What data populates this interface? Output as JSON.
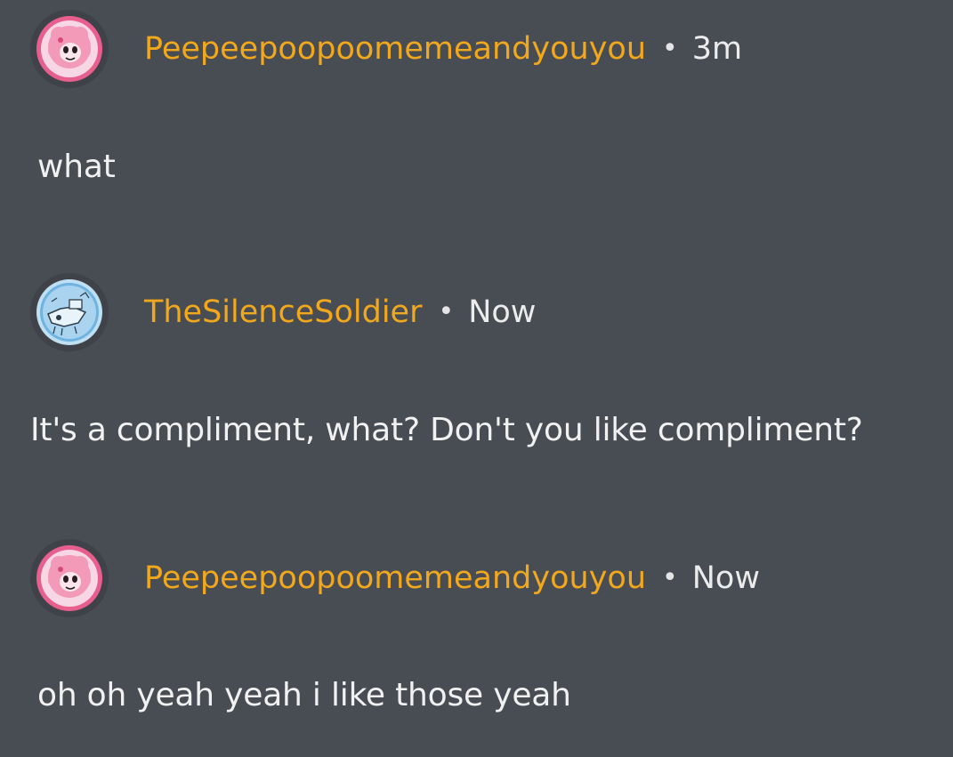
{
  "comments": [
    {
      "username": "Peepeepoopoomemeandyouyou",
      "separator": "•",
      "time": "3m",
      "text": "what",
      "avatar_icon": "pink-character-avatar-icon"
    },
    {
      "username": "TheSilenceSoldier",
      "separator": "•",
      "time": "Now",
      "text": "It's a compliment, what? Don't you like compliment?",
      "avatar_icon": "blue-sketch-avatar-icon"
    },
    {
      "username": "Peepeepoopoomemeandyouyou",
      "separator": "•",
      "time": "Now",
      "text": "oh oh yeah yeah i like those yeah",
      "avatar_icon": "pink-character-avatar-icon"
    }
  ],
  "colors": {
    "background": "#484c53",
    "username": "#f2a81d",
    "text": "#f1f1f1",
    "avatar_ring_pink": "#e85f8e",
    "avatar_ring_blue": "#8fc5e8"
  }
}
